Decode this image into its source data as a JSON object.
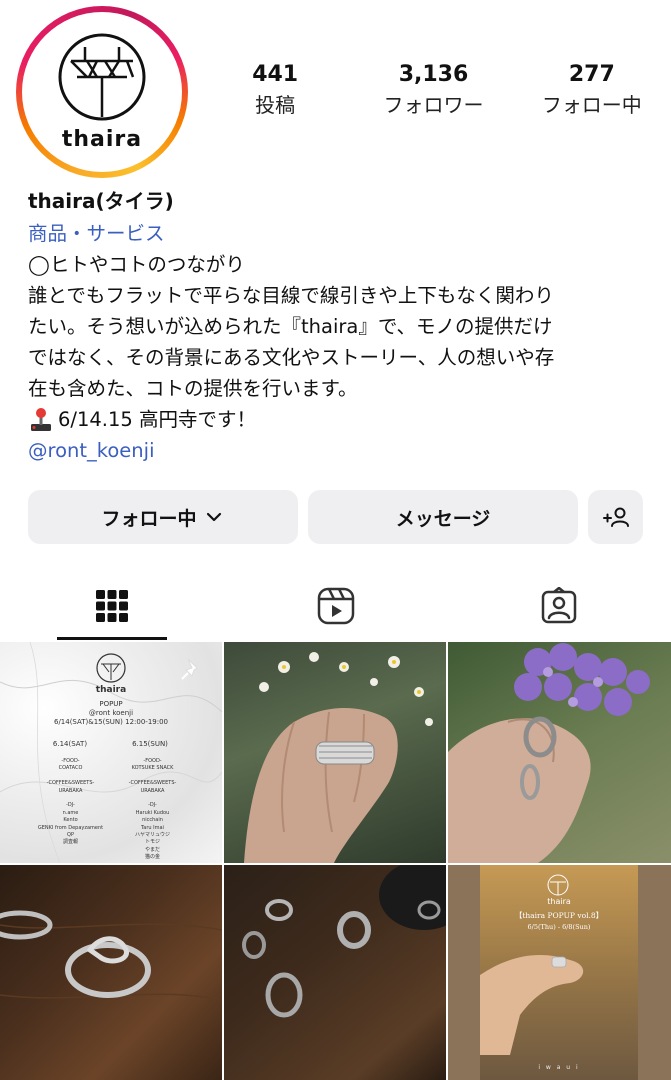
{
  "profile": {
    "avatar_logo_text": "thaira",
    "display_name": "thaira(タイラ)",
    "category": "商品・サービス",
    "bio_lines": [
      "◯ヒトやコトのつながり",
      "誰とでもフラットで平らな目線で線引きや上下もなく関わり",
      "たい。そう想いが込められた『thaira』で、モノの提供だけ",
      "ではなく、その背景にある文化やストーリー、人の想いや存",
      "在も含めた、コトの提供を行います。"
    ],
    "event_line": "6/14.15 高円寺です！",
    "mention": "@ront_koenji"
  },
  "stats": [
    {
      "value": "441",
      "label": "投稿"
    },
    {
      "value": "3,136",
      "label": "フォロワー"
    },
    {
      "value": "277",
      "label": "フォロー中"
    }
  ],
  "buttons": {
    "following": "フォロー中",
    "message": "メッセージ"
  },
  "tabs": [
    {
      "icon": "grid-icon"
    },
    {
      "icon": "reels-icon"
    },
    {
      "icon": "tagged-icon"
    }
  ],
  "posts": {
    "popup_poster": {
      "brand": "thaira",
      "title": "POPUP",
      "venue": "@ront koenji",
      "dates": "6/14(SAT)&15(SUN) 12:00-19:00",
      "day1": "6.14(SAT)",
      "day2": "6.15(SUN)",
      "left_col": [
        "-FOOD-",
        "COATACO",
        "",
        "-COFFEE&SWEETS-",
        "URABAKA",
        "",
        "-DJ-",
        "n.ame",
        "Kento",
        "GENKI from Depayzament",
        "QP",
        "調査報"
      ],
      "right_col": [
        "-FOOD-",
        "KOTSUKE SNACK",
        "",
        "-COFFEE&SWEETS-",
        "URABAKA",
        "",
        "-DJ-",
        "Haruki Kudou",
        "nicchain",
        "Taru Imai",
        "ハヤマリュウジ",
        "トモジ",
        "やまだ",
        "猫の金"
      ]
    },
    "popup_vol8": {
      "brand": "thaira",
      "title": "【thaira POPUP vol.8】",
      "dates": "6/5(Thu) - 6/8(Sun)",
      "footer": "i w a u i"
    }
  }
}
